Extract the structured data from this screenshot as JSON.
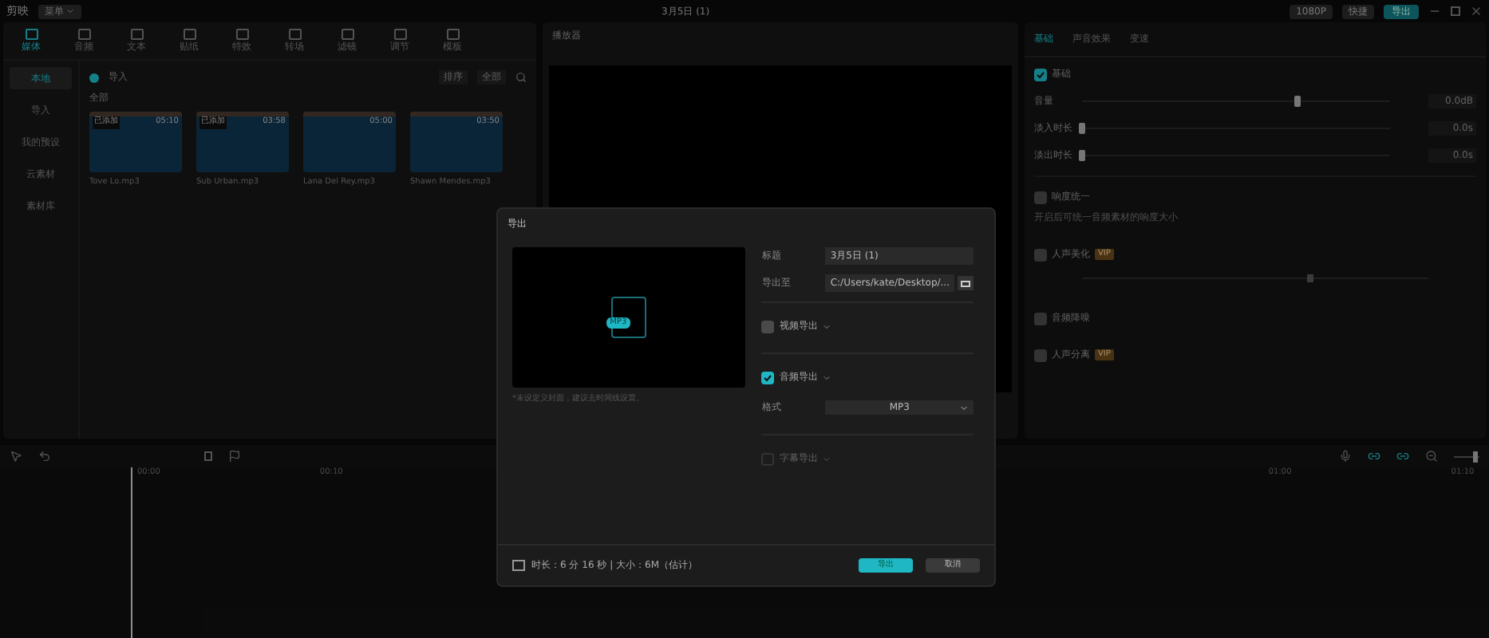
{
  "app": {
    "name": "剪映",
    "menu": "菜单",
    "project_title": "3月5日 (1)",
    "resolution": "1080P",
    "shortcut": "快捷",
    "export": "导出"
  },
  "toolbar_tabs": [
    {
      "label": "媒体",
      "selected": true
    },
    {
      "label": "音频",
      "selected": false
    },
    {
      "label": "文本",
      "selected": false
    },
    {
      "label": "贴纸",
      "selected": false
    },
    {
      "label": "特效",
      "selected": false
    },
    {
      "label": "转场",
      "selected": false
    },
    {
      "label": "滤镜",
      "selected": false
    },
    {
      "label": "调节",
      "selected": false
    },
    {
      "label": "模板",
      "selected": false
    }
  ],
  "sidebar": [
    {
      "label": "本地",
      "selected": true
    },
    {
      "label": "导入",
      "selected": false
    },
    {
      "label": "我的预设",
      "selected": false
    },
    {
      "label": "云素材",
      "selected": false
    },
    {
      "label": "素材库",
      "selected": false
    }
  ],
  "media": {
    "import": "导入",
    "sort": "排序",
    "all": "全部",
    "section": "全部",
    "items": [
      {
        "badge": "已添加",
        "duration": "05:10",
        "name": "Tove Lo.mp3"
      },
      {
        "badge": "已添加",
        "duration": "03:58",
        "name": "Sub Urban.mp3"
      },
      {
        "duration": "05:00",
        "name": "Lana Del Rey.mp3"
      },
      {
        "duration": "03:50",
        "name": "Shawn Mendes.mp3"
      }
    ]
  },
  "player": {
    "title": "播放器"
  },
  "inspector": {
    "tabs": [
      {
        "label": "基础",
        "selected": true
      },
      {
        "label": "声音效果",
        "selected": false
      },
      {
        "label": "变速",
        "selected": false
      }
    ],
    "basic": {
      "label": "基础",
      "checked": true
    },
    "sliders": [
      {
        "label": "音量",
        "level": 0.7,
        "reading": "0.0dB"
      },
      {
        "label": "淡入时长",
        "level": 0,
        "reading": "0.0s"
      },
      {
        "label": "淡出时长",
        "level": 0,
        "reading": "0.0s"
      }
    ],
    "options": [
      {
        "label": "响度统一",
        "checked": false,
        "hint": "开启后可统一音频素材的响度大小"
      },
      {
        "label": "人声美化",
        "checked": false,
        "badge": "VIP",
        "level": 0.66
      },
      {
        "label": "音频降噪",
        "checked": false
      },
      {
        "label": "人声分离",
        "checked": false,
        "badge": "VIP"
      }
    ]
  },
  "timeline": {
    "zoom": {
      "level": 0.8
    },
    "ticks_left": [
      "00:00",
      "00:10"
    ],
    "ticks_right": [
      "01:00",
      "01:10"
    ]
  },
  "dialog": {
    "title": "导出",
    "preview_badge": "MP3",
    "cover_hint": "*未设定义封面，建议去时间线设置。",
    "fields": [
      {
        "label": "标题",
        "value": "3月5日 (1)"
      },
      {
        "label": "导出至",
        "value": "C:/Users/kate/Desktop/..."
      }
    ],
    "sections": [
      {
        "label": "视频导出",
        "checked": false,
        "disabled": false
      },
      {
        "label": "音频导出",
        "checked": true,
        "disabled": false,
        "format_label": "格式",
        "format": "MP3"
      },
      {
        "label": "字幕导出",
        "checked": false,
        "disabled": true
      }
    ],
    "summary": "时长：6 分 16 秒 | 大小：6M（估计）",
    "buttons": [
      {
        "label": "导出",
        "kind": "primary"
      },
      {
        "label": "取消",
        "kind": "secondary"
      }
    ]
  }
}
